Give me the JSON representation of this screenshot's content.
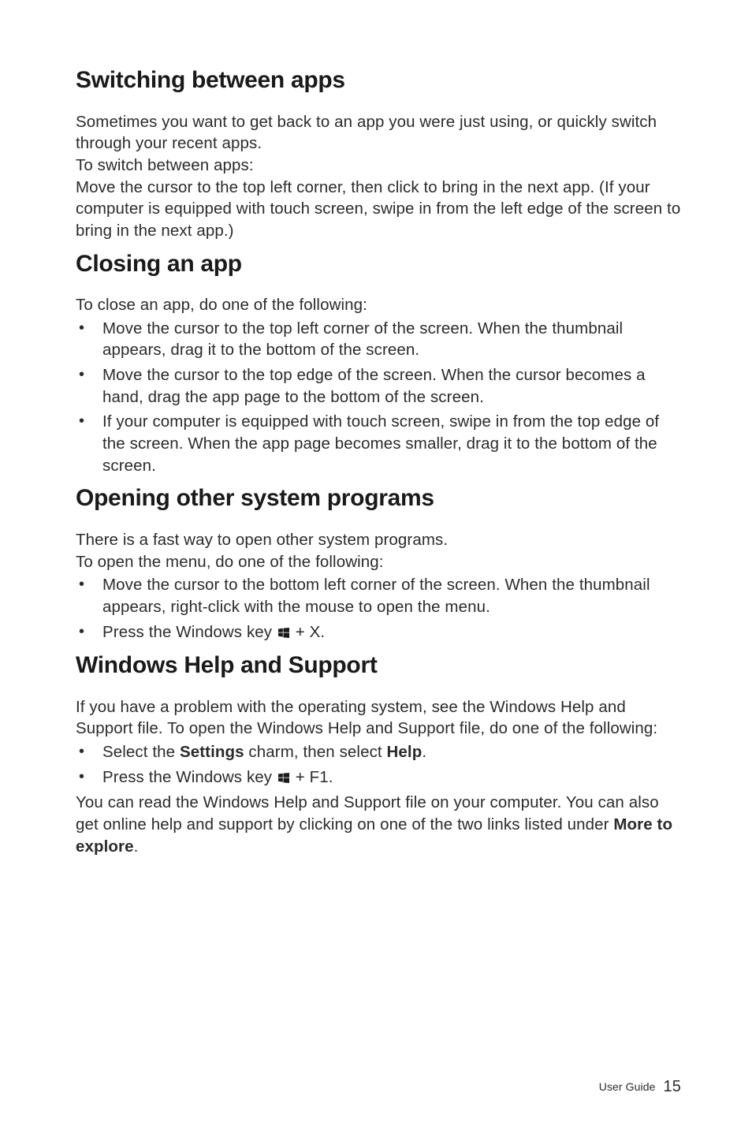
{
  "sections": {
    "switching": {
      "heading": "Switching between apps",
      "p1": "Sometimes you want to get back to an app you were just using, or quickly switch through your recent apps.",
      "p2": "To switch between apps:",
      "p3": "Move the cursor to the top left corner, then click to bring in the next app. (If your computer is equipped with touch screen, swipe in from the left edge of the screen to bring in the next app.)"
    },
    "closing": {
      "heading": "Closing an app",
      "intro": "To close an app, do one of the following:",
      "items": [
        "Move the cursor to the top left corner of the screen. When the thumbnail appears, drag it to the bottom of the screen.",
        "Move the cursor to the top edge of the screen. When the cursor becomes a hand, drag the app page to the bottom of the screen.",
        "If your computer is equipped with touch screen, swipe in from the top edge of the screen. When the app page becomes smaller, drag it to the bottom of the screen."
      ]
    },
    "opening": {
      "heading": "Opening other system programs",
      "p1": "There is a fast way to open other system programs.",
      "p2": "To open the menu, do one of the following:",
      "items": [
        "Move the cursor to the bottom left corner of the screen. When the thumbnail appears, right-click with the mouse to open the menu."
      ],
      "winkey_pre": "Press the Windows key ",
      "winkey_post": " + X."
    },
    "help": {
      "heading": "Windows Help and Support",
      "intro": "If you have a problem with the operating system, see the Windows Help and Support file. To open the Windows Help and Support file, do one of the following:",
      "item_select_pre": "Select the ",
      "item_select_settings": "Settings",
      "item_select_mid": " charm, then select ",
      "item_select_help": "Help",
      "item_select_post": ".",
      "winkey_pre": "Press the Windows key ",
      "winkey_post": " + F1.",
      "outro_pre": "You can read the Windows Help and Support file on your computer. You can also get online help and support by clicking on one of the two links listed under ",
      "outro_bold": "More to explore",
      "outro_post": "."
    }
  },
  "footer": {
    "label": "User Guide",
    "page": "15"
  }
}
